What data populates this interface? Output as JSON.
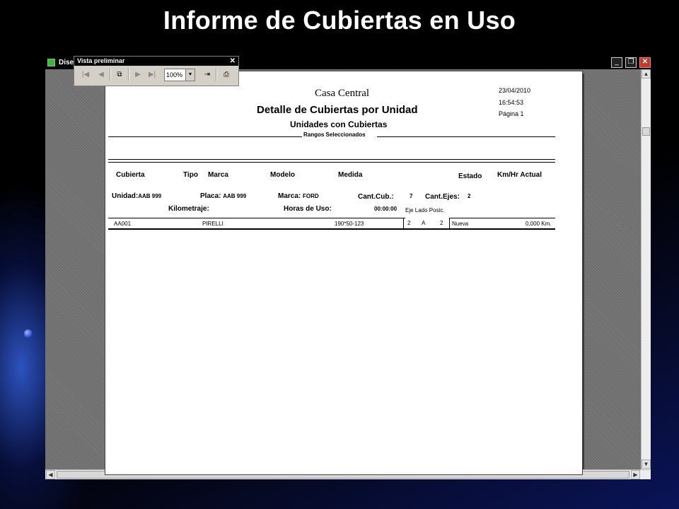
{
  "slide": {
    "title": "Informe de Cubiertas en Uso"
  },
  "window": {
    "title": "Dise"
  },
  "toolbar": {
    "title": "Vista preliminar",
    "close": "✕",
    "zoom": "100%"
  },
  "report": {
    "company": "Casa Central",
    "title": "Detalle de Cubiertas por Unidad",
    "subtitle": "Unidades con Cubiertas",
    "ranges_label": "Rangos Seleccionados",
    "date": "23/04/2010",
    "time": "16:54:53",
    "page": "Página 1",
    "columns": {
      "cubierta": "Cubierta",
      "tipo": "Tipo",
      "marca": "Marca",
      "modelo": "Modelo",
      "medida": "Medida",
      "estado": "Estado",
      "kmhr": "Km/Hr Actual"
    },
    "unit": {
      "unidad_label": "Unidad:",
      "unidad_value": "AAB 999",
      "placa_label": "Placa:",
      "placa_value": "AAB 999",
      "marca_label": "Marca:",
      "marca_value": "FORD",
      "cantcub_label": "Cant.Cub.:",
      "cantcub_value": "7",
      "cantejes_label": "Cant.Ejes:",
      "cantejes_value": "2",
      "km_label": "Kilometraje:",
      "horas_label": "Horas de Uso:",
      "horas_value": "00:00:00",
      "pos_header": "Eje Lado Posic."
    },
    "rows": [
      {
        "cubierta": "AA001",
        "marca": "PIRELLI",
        "medida": "190*50-123",
        "eje": "2",
        "lado": "A",
        "posic": "2",
        "estado": "Nueva",
        "km": "0,000 Km."
      }
    ]
  }
}
